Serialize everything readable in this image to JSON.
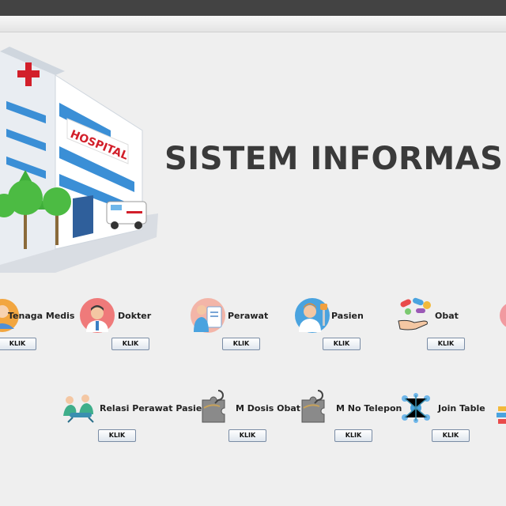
{
  "header": {
    "title": "SISTEM INFORMASI"
  },
  "menu": {
    "row1": [
      {
        "label": "Tenaga Medis",
        "button": "KLIK",
        "icon": "medical-staff-icon"
      },
      {
        "label": "Dokter",
        "button": "KLIK",
        "icon": "doctor-icon"
      },
      {
        "label": "Perawat",
        "button": "KLIK",
        "icon": "nurse-icon"
      },
      {
        "label": "Pasien",
        "button": "KLIK",
        "icon": "patient-icon"
      },
      {
        "label": "Obat",
        "button": "KLIK",
        "icon": "medicine-icon"
      }
    ],
    "row2": [
      {
        "label": "Relasi Perawat Pasien",
        "button": "KLIK",
        "icon": "nurse-patient-relation-icon"
      },
      {
        "label": "M Dosis Obat",
        "button": "KLIK",
        "icon": "puzzle-key-icon"
      },
      {
        "label": "M No Telepon",
        "button": "KLIK",
        "icon": "puzzle-key-icon"
      },
      {
        "label": "Join Table",
        "button": "KLIK",
        "icon": "network-join-icon"
      }
    ]
  },
  "hospital_sign": "HOSPITAL"
}
